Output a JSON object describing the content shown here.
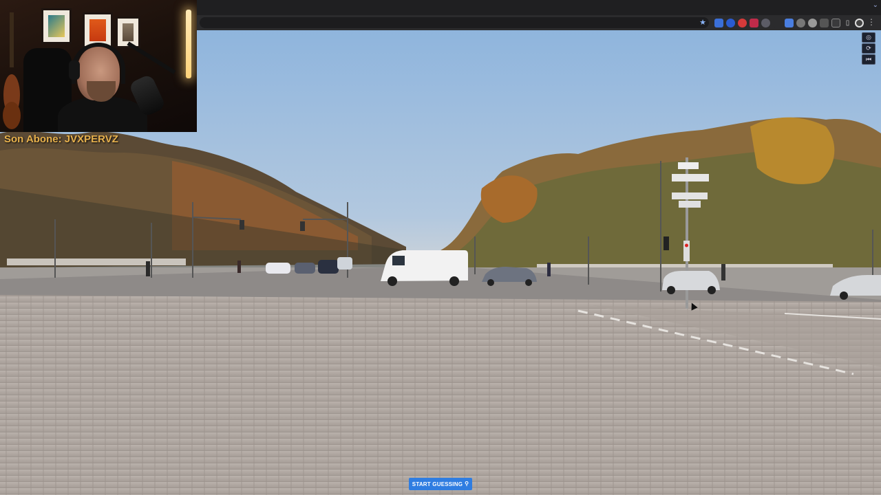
{
  "overlay": {
    "sub_label": "Son Abone: JVXPERVZ"
  },
  "game": {
    "start_button_label": "START GUESSING",
    "start_button_icon": "map-pin-icon",
    "accent_color": "#2f7de1"
  },
  "controls": {
    "icons": [
      "compass-icon",
      "refresh-icon",
      "return-to-start-icon"
    ]
  },
  "browser": {
    "toolbar_icons": [
      "bookmark-star-icon",
      "extension-icon",
      "extension-icon",
      "extension-icon",
      "extension-icon",
      "extension-icon",
      "extension-icon",
      "extension-icon",
      "extension-icon",
      "extension-icon",
      "extension-icon",
      "puzzle-icon",
      "profile-avatar-icon",
      "kebab-menu-icon"
    ]
  }
}
